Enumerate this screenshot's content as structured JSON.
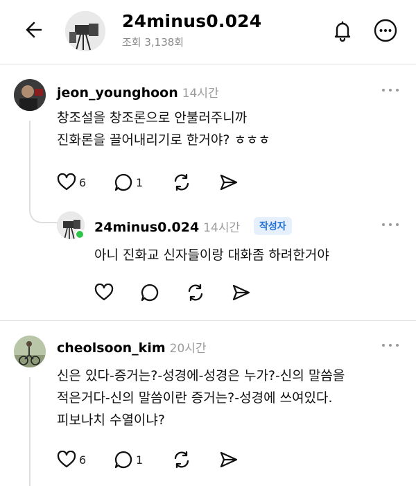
{
  "header": {
    "title": "24minus0.024",
    "subtitle": "조회 3,138회"
  },
  "comments": [
    {
      "username": "jeon_younghoon",
      "time": "14시간",
      "text": "창조설을 창조론으로 안불러주니까\n진화론을 끌어내리기로 한거야? ㅎㅎㅎ",
      "likes": "6",
      "replies": "1"
    },
    {
      "username": "24minus0.024",
      "time": "14시간",
      "badge": "작성자",
      "text": "아니 진화교 신자들이랑 대화좀 하려한거야"
    },
    {
      "username": "cheolsoon_kim",
      "time": "20시간",
      "text": "신은 있다-증거는?-성경에-성경은 누가?-신의 말씀을\n적은거다-신의 말씀이란 증거는?-성경에 쓰여있다.\n피보나치 수열이냐?",
      "likes": "6",
      "replies": "1"
    }
  ],
  "icons": {
    "back": "arrow-left-icon",
    "bell": "bell-icon",
    "more": "more-circle-icon",
    "like": "heart-icon",
    "reply": "speech-bubble-icon",
    "repost": "repost-icon",
    "share": "send-icon"
  },
  "colors": {
    "badge_text": "#1f6fd6",
    "badge_bg": "#e6f0fc",
    "online": "#2fc44a",
    "muted": "#9a9a9a"
  }
}
